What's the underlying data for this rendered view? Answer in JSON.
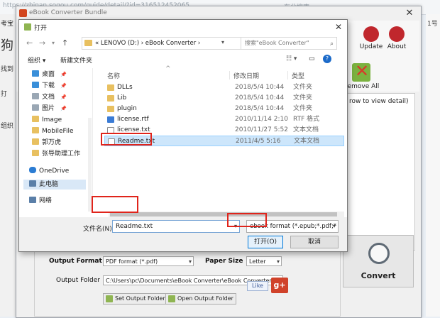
{
  "background": {
    "url_text": "https://zhinan.sogou.com/guide/detail/?id=316512452065",
    "right_text": "在此搜索",
    "left_col": [
      "考宝",
      "狗",
      "找到",
      "打",
      "组织"
    ],
    "right_col": [
      "1号"
    ]
  },
  "app": {
    "title": "eBook Converter Bundle",
    "toolbar": {
      "update": "Update",
      "about": "About",
      "remove_all": "Remove All"
    },
    "drop_hint": "row to view detail)",
    "settings": {
      "output_format_label": "Output Format",
      "output_format_value": "PDF format (*.pdf)",
      "paper_size_label": "Paper Size",
      "paper_size_value": "Letter",
      "output_folder_label": "Output Folder",
      "output_folder_value": "C:\\Users\\pc\\Documents\\eBook Converter\\eBook Converter Bun",
      "set_output_folder": "Set Output Folder",
      "open_output_folder": "Open Output Folder",
      "like": "Like",
      "gplus": "g+"
    },
    "convert": "Convert"
  },
  "dialog": {
    "title": "打开",
    "address": "«  LENOVO (D:)  ›  eBook Converter  ›",
    "search_placeholder": "搜索\"eBook Converter\"",
    "organize": "组织 ▾",
    "new_folder": "新建文件夹",
    "nav_items": [
      "桌面",
      "下载",
      "文档",
      "图片",
      "Image",
      "MobileFile",
      "郭万虎",
      "张导助理工作",
      "OneDrive",
      "此电脑",
      "网络"
    ],
    "columns": {
      "name": "名称",
      "date": "修改日期",
      "type": "类型"
    },
    "files": [
      {
        "name": "DLLs",
        "date": "2018/5/4 10:44",
        "type": "文件夹",
        "kind": "folder"
      },
      {
        "name": "Lib",
        "date": "2018/5/4 10:44",
        "type": "文件夹",
        "kind": "folder"
      },
      {
        "name": "plugin",
        "date": "2018/5/4 10:44",
        "type": "文件夹",
        "kind": "folder"
      },
      {
        "name": "license.rtf",
        "date": "2010/11/14 2:10",
        "type": "RTF 格式",
        "kind": "rtf"
      },
      {
        "name": "license.txt",
        "date": "2010/11/27 5:52",
        "type": "文本文档",
        "kind": "doc"
      },
      {
        "name": "Readme.txt",
        "date": "2011/4/5 5:16",
        "type": "文本文档",
        "kind": "doc"
      }
    ],
    "filename_label": "文件名(N):",
    "filename_value": "Readme.txt",
    "filter_value": "ebook format (*.epub;*.pdf;*",
    "open_button": "打开(O)",
    "cancel_button": "取消"
  },
  "colors": {
    "highlight_red": "#e0241b",
    "selection_blue": "#cde6fb",
    "accent_blue": "#0078d7"
  }
}
